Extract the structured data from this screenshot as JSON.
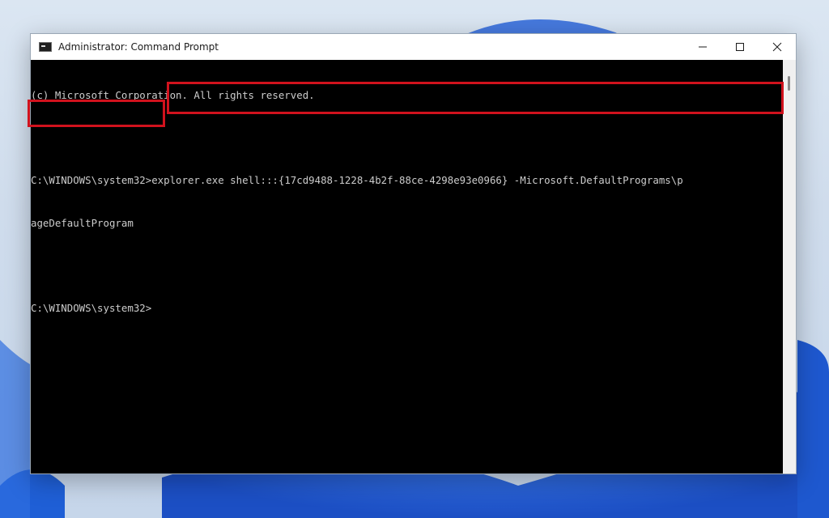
{
  "window": {
    "title": "Administrator: Command Prompt",
    "icon": "command-prompt-icon"
  },
  "controls": {
    "minimize": "minimize-icon",
    "maximize": "maximize-icon",
    "close": "close-icon"
  },
  "console": {
    "copyright": "(c) Microsoft Corporation. All rights reserved.",
    "prompt": "C:\\WINDOWS\\system32>",
    "command_part1": "explorer.exe shell:::{17cd9488-1228-4b2f-88ce-4298e93e0966} -Microsoft.DefaultPrograms\\p",
    "command_part2": "ageDefaultProgram",
    "prompt2": "C:\\WINDOWS\\system32>"
  },
  "colors": {
    "console_background": "#000000",
    "console_text": "#cccccc",
    "highlight": "#d1121d"
  }
}
